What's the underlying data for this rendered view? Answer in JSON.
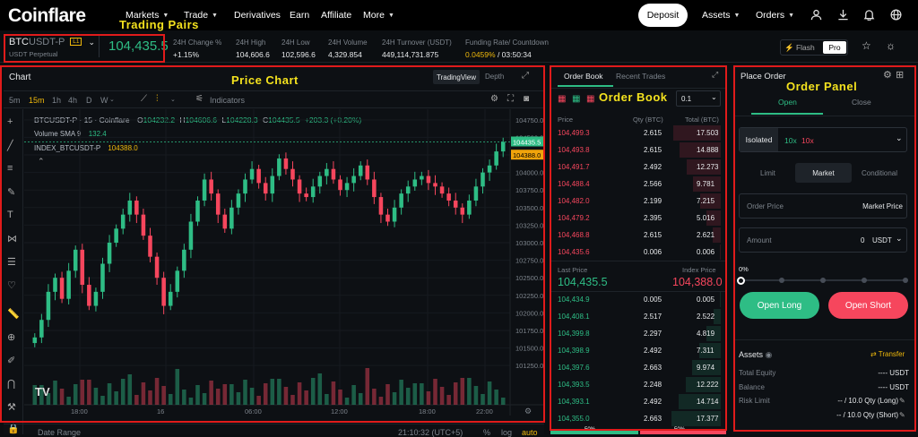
{
  "brand": {
    "name": "Coinflare"
  },
  "nav": {
    "items": [
      {
        "label": "Markets",
        "dropdown": true
      },
      {
        "label": "Trade",
        "dropdown": true
      },
      {
        "label": "Derivatives",
        "dropdown": false
      },
      {
        "label": "Earn",
        "dropdown": false
      },
      {
        "label": "Affiliate",
        "dropdown": false
      },
      {
        "label": "More",
        "dropdown": true
      }
    ],
    "deposit": "Deposit",
    "assets": "Assets",
    "orders": "Orders",
    "icons": [
      "user-icon",
      "download-icon",
      "bell-icon",
      "globe-icon"
    ]
  },
  "ticker": {
    "symbol_base": "BTC",
    "symbol_quote": "USDT-P",
    "leverage_badge": "L1",
    "subtitle": "USDT Perpetual",
    "price": "104,435.5",
    "stats": [
      {
        "label": "24H Change %",
        "value": "+1.15%",
        "color": "green"
      },
      {
        "label": "24H High",
        "value": "104,606.6",
        "color": "white"
      },
      {
        "label": "24H Low",
        "value": "102,596.6",
        "color": "white"
      },
      {
        "label": "24H Volume",
        "value": "4,329.854",
        "color": "white"
      },
      {
        "label": "24H Turnover (USDT)",
        "value": "449,114,731.875",
        "color": "white"
      }
    ],
    "funding_label": "Funding Rate/ Countdown",
    "funding_rate": "0.0459%",
    "funding_countdown": "/ 03:50:34",
    "flash": "Flash",
    "pro": "Pro"
  },
  "annotations": {
    "trading_pairs": "Trading Pairs",
    "price_chart": "Price Chart",
    "order_book": "Order Book",
    "order_panel": "Order Panel"
  },
  "chart": {
    "title": "Chart",
    "view_tabs": [
      "TradingView",
      "Depth"
    ],
    "intervals": [
      "5m",
      "15m",
      "1h",
      "4h",
      "D",
      "W"
    ],
    "active_interval": "15m",
    "indicators": "Indicators",
    "legend_symbol": "BTCUSDT-P · 15 · Coinflare",
    "ohlc": {
      "o": "104232.2",
      "h": "104606.6",
      "l": "104228.3",
      "c": "104435.5",
      "chg": "+203.3 (+0.20%)"
    },
    "sma_label": "Volume SMA 9",
    "sma_value": "132.4",
    "index_label": "INDEX_BTCUSDT-P",
    "index_value": "104388.0",
    "y_ticks": [
      "104750.0",
      "104500.0",
      "104250.0",
      "104000.0",
      "103750.0",
      "103500.0",
      "103250.0",
      "103000.0",
      "102750.0",
      "102500.0",
      "102250.0",
      "102000.0",
      "101750.0",
      "101500.0",
      "101250.0"
    ],
    "x_ticks": [
      "18:00",
      "16",
      "06:00",
      "12:00",
      "18:00",
      "22:00"
    ],
    "last_price_tag": "104435.5",
    "index_price_tag": "104388.0",
    "date_range": "Date Range",
    "time_display": "21:10:32 (UTC+5)",
    "scale_opts": [
      "%",
      "log",
      "auto"
    ]
  },
  "chart_data": {
    "type": "candlestick",
    "interval": "15m",
    "ylim": [
      101150,
      104850
    ],
    "candles_close_approx": [
      101650,
      101900,
      102300,
      102500,
      102200,
      102600,
      102900,
      102400,
      102100,
      102300,
      102700,
      103000,
      103200,
      103400,
      103600,
      103400,
      103100,
      102800,
      102500,
      102100,
      102300,
      102600,
      102900,
      103300,
      103600,
      103900,
      103700,
      103400,
      103200,
      103500,
      103700,
      103900,
      104050,
      103850,
      103700,
      103950,
      104200,
      104050,
      103900,
      103700,
      103650,
      103800,
      103950,
      104050,
      103900,
      103750,
      103850,
      103950,
      104100,
      103900,
      103650,
      103400,
      103300,
      103500,
      103700,
      103800,
      103900,
      103950,
      103850,
      103800,
      103700,
      103600,
      103500,
      103400,
      103600,
      103800,
      104000,
      104100,
      104300,
      104435.5
    ]
  },
  "orderbook": {
    "tabs": [
      "Order Book",
      "Recent Trades"
    ],
    "precision": "0.1",
    "headers": [
      "Price",
      "Qty (BTC)",
      "Total (BTC)"
    ],
    "asks": [
      {
        "price": "104,499.3",
        "qty": "2.615",
        "total": "17.503",
        "depth": 0.95
      },
      {
        "price": "104,493.8",
        "qty": "2.615",
        "total": "14.888",
        "depth": 0.82
      },
      {
        "price": "104,491.7",
        "qty": "2.492",
        "total": "12.273",
        "depth": 0.68
      },
      {
        "price": "104,488.4",
        "qty": "2.566",
        "total": "9.781",
        "depth": 0.55
      },
      {
        "price": "104,482.0",
        "qty": "2.199",
        "total": "7.215",
        "depth": 0.41
      },
      {
        "price": "104,479.2",
        "qty": "2.395",
        "total": "5.016",
        "depth": 0.29
      },
      {
        "price": "104,468.8",
        "qty": "2.615",
        "total": "2.621",
        "depth": 0.16
      },
      {
        "price": "104,435.6",
        "qty": "0.006",
        "total": "0.006",
        "depth": 0.01
      }
    ],
    "last_price_label": "Last Price",
    "index_price_label": "Index Price",
    "last_price": "104,435.5",
    "index_price": "104,388.0",
    "bids": [
      {
        "price": "104,434.9",
        "qty": "0.005",
        "total": "0.005",
        "depth": 0.01
      },
      {
        "price": "104,408.1",
        "qty": "2.517",
        "total": "2.522",
        "depth": 0.15
      },
      {
        "price": "104,399.8",
        "qty": "2.297",
        "total": "4.819",
        "depth": 0.28
      },
      {
        "price": "104,398.9",
        "qty": "2.492",
        "total": "7.311",
        "depth": 0.42
      },
      {
        "price": "104,397.6",
        "qty": "2.663",
        "total": "9.974",
        "depth": 0.57
      },
      {
        "price": "104,393.5",
        "qty": "2.248",
        "total": "12.222",
        "depth": 0.7
      },
      {
        "price": "104,393.1",
        "qty": "2.492",
        "total": "14.714",
        "depth": 0.84
      },
      {
        "price": "104,355.0",
        "qty": "2.663",
        "total": "17.377",
        "depth": 0.99
      }
    ],
    "ratio_buy": "50%",
    "ratio_sell": "50%"
  },
  "order_panel": {
    "title": "Place Order",
    "tabs": [
      "Open",
      "Close"
    ],
    "margin_mode": "Isolated",
    "lev_long": "10x",
    "lev_short": "10x",
    "order_types": [
      "Limit",
      "Market",
      "Conditional"
    ],
    "active_type": "Market",
    "order_price_label": "Order Price",
    "order_price_value": "Market Price",
    "amount_label": "Amount",
    "amount_value": "0",
    "amount_unit": "USDT",
    "slider_pct": "0%",
    "slider_value": 0,
    "open_long": "Open Long",
    "open_short": "Open Short",
    "assets_title": "Assets",
    "transfer": "Transfer",
    "asset_rows": [
      {
        "label": "Total Equity",
        "value": "---- USDT"
      },
      {
        "label": "Balance",
        "value": "---- USDT"
      },
      {
        "label": "Risk Limit",
        "value": "-- / 10.0 Qty (Long)"
      },
      {
        "label": "",
        "value": "-- / 10.0 Qty (Short)"
      }
    ]
  }
}
